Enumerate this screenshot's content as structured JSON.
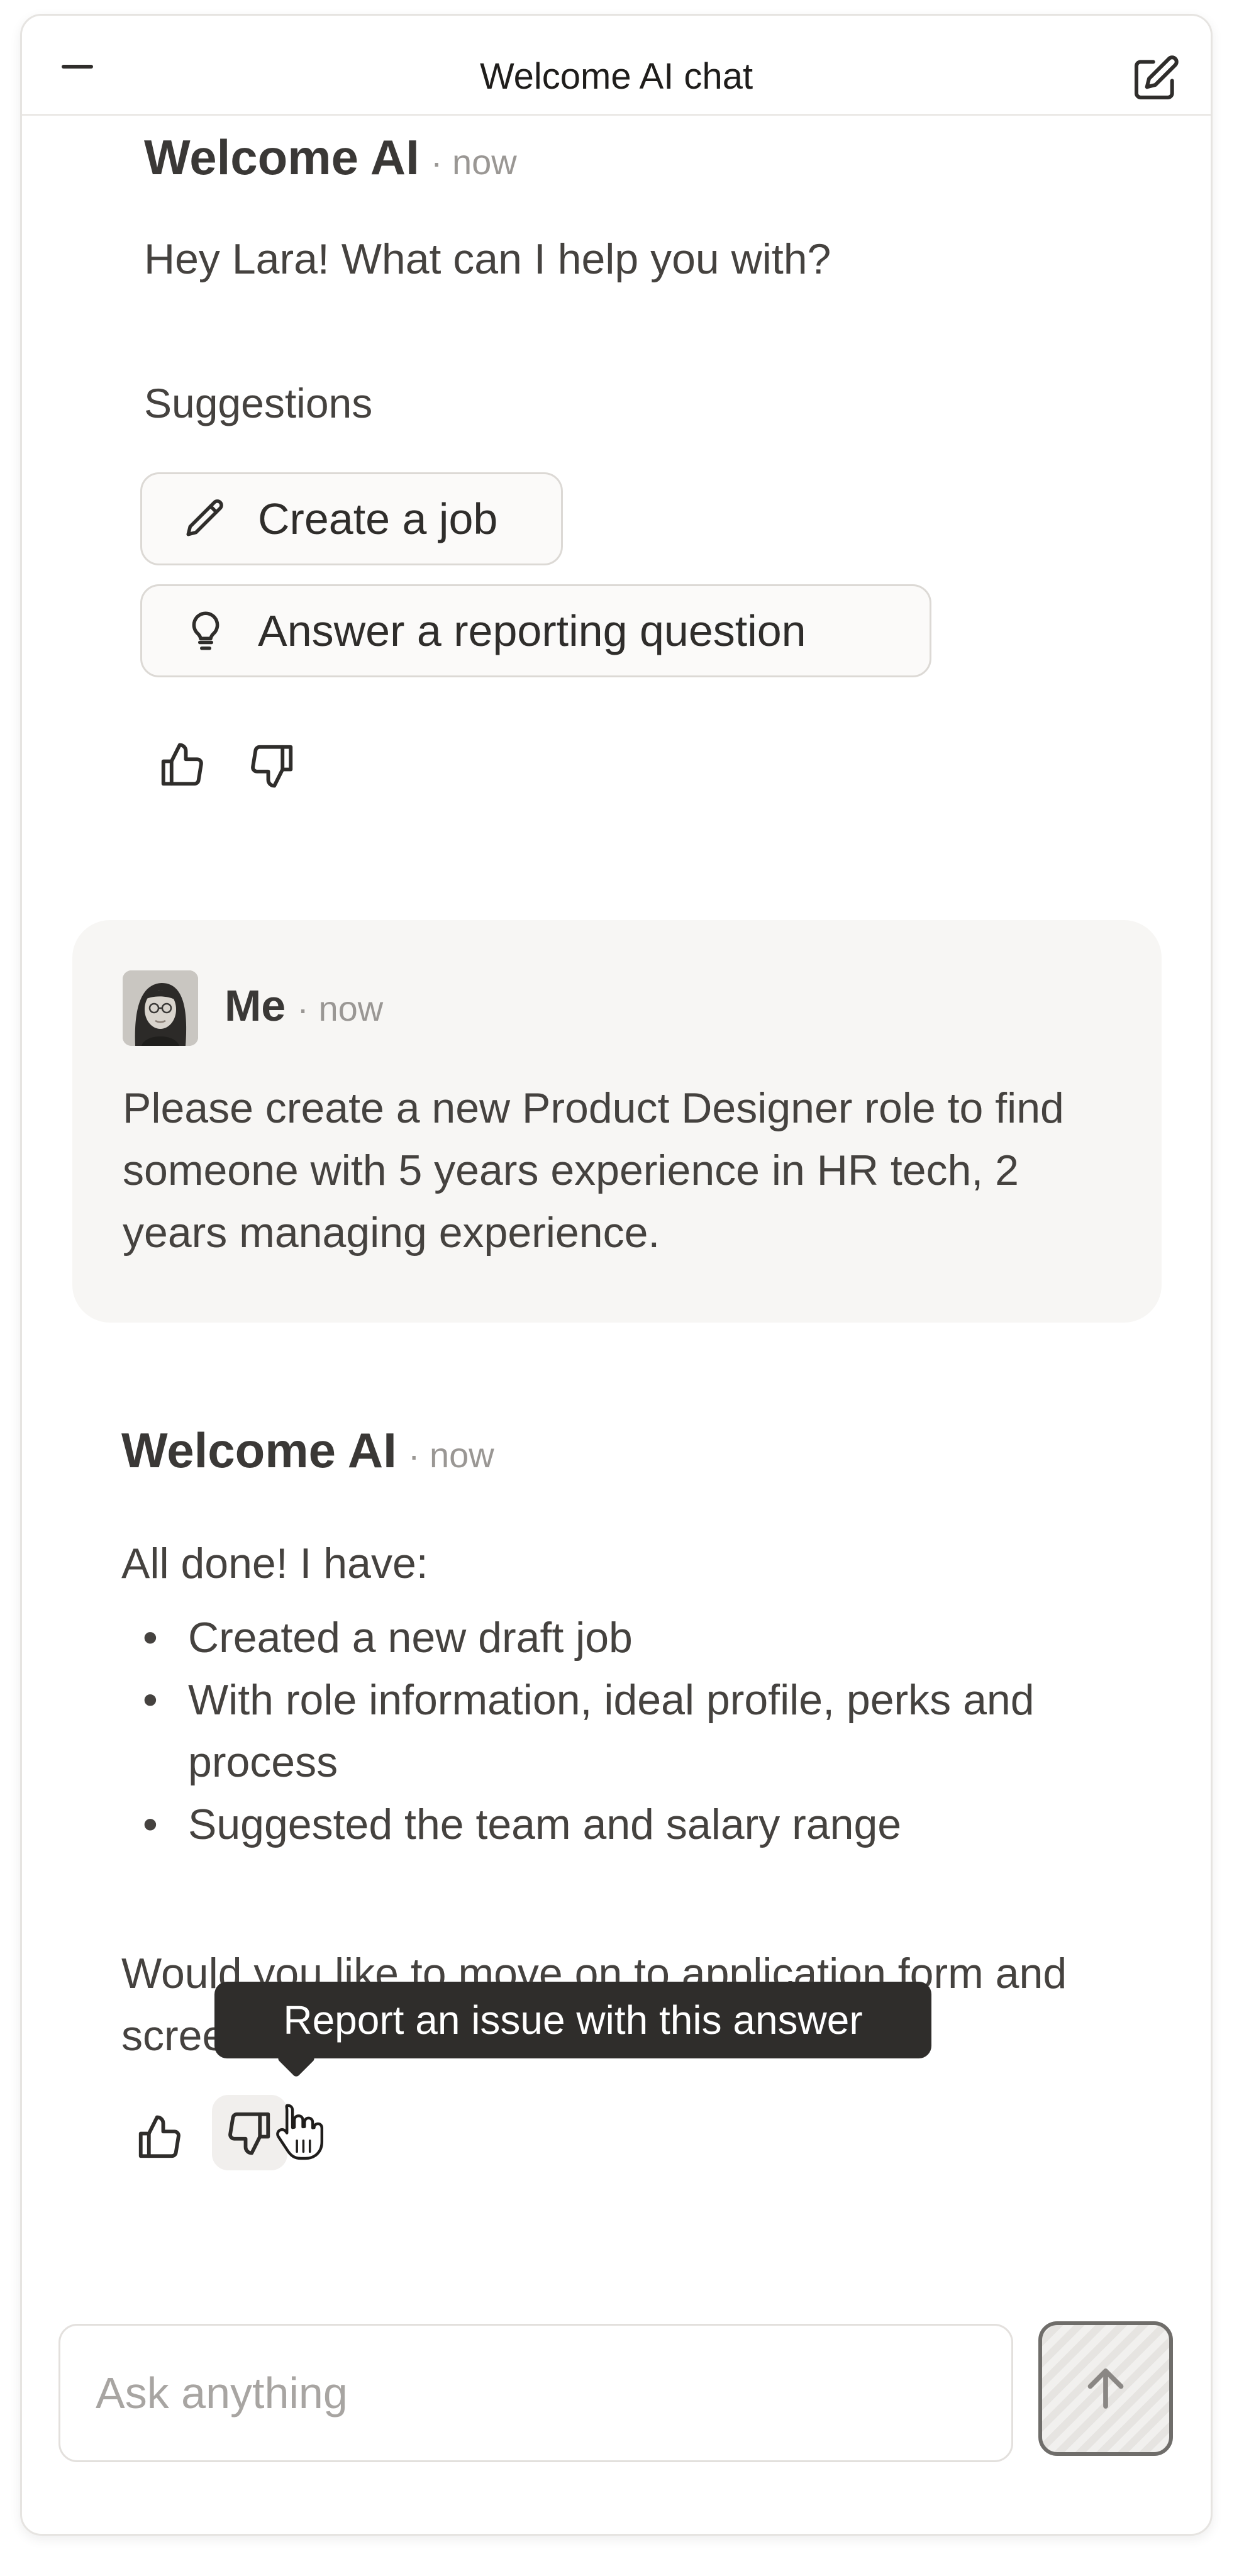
{
  "header": {
    "title": "Welcome AI chat"
  },
  "welcome": {
    "sender": "Welcome AI",
    "meta": "· now",
    "greeting": "Hey Lara! What can I help you with?",
    "suggestions_label": "Suggestions",
    "suggestions": [
      {
        "label": "Create a job",
        "icon": "pencil-icon"
      },
      {
        "label": "Answer a reporting question",
        "icon": "lightbulb-icon"
      }
    ]
  },
  "user_message": {
    "sender": "Me",
    "meta": "· now",
    "text": "Please create a new Product Designer role to find someone with 5 years experience in HR tech, 2 years managing experience."
  },
  "reply": {
    "sender": "Welcome AI",
    "meta": "· now",
    "intro": "All done! I have:",
    "bullets": [
      "Created a new draft job",
      "With role information, ideal profile, perks and process",
      "Suggested the team and salary range"
    ],
    "question": "Would you like to move on to application form and screening criteria?"
  },
  "tooltip": {
    "text": "Report an issue with this answer"
  },
  "composer": {
    "placeholder": "Ask anything"
  }
}
